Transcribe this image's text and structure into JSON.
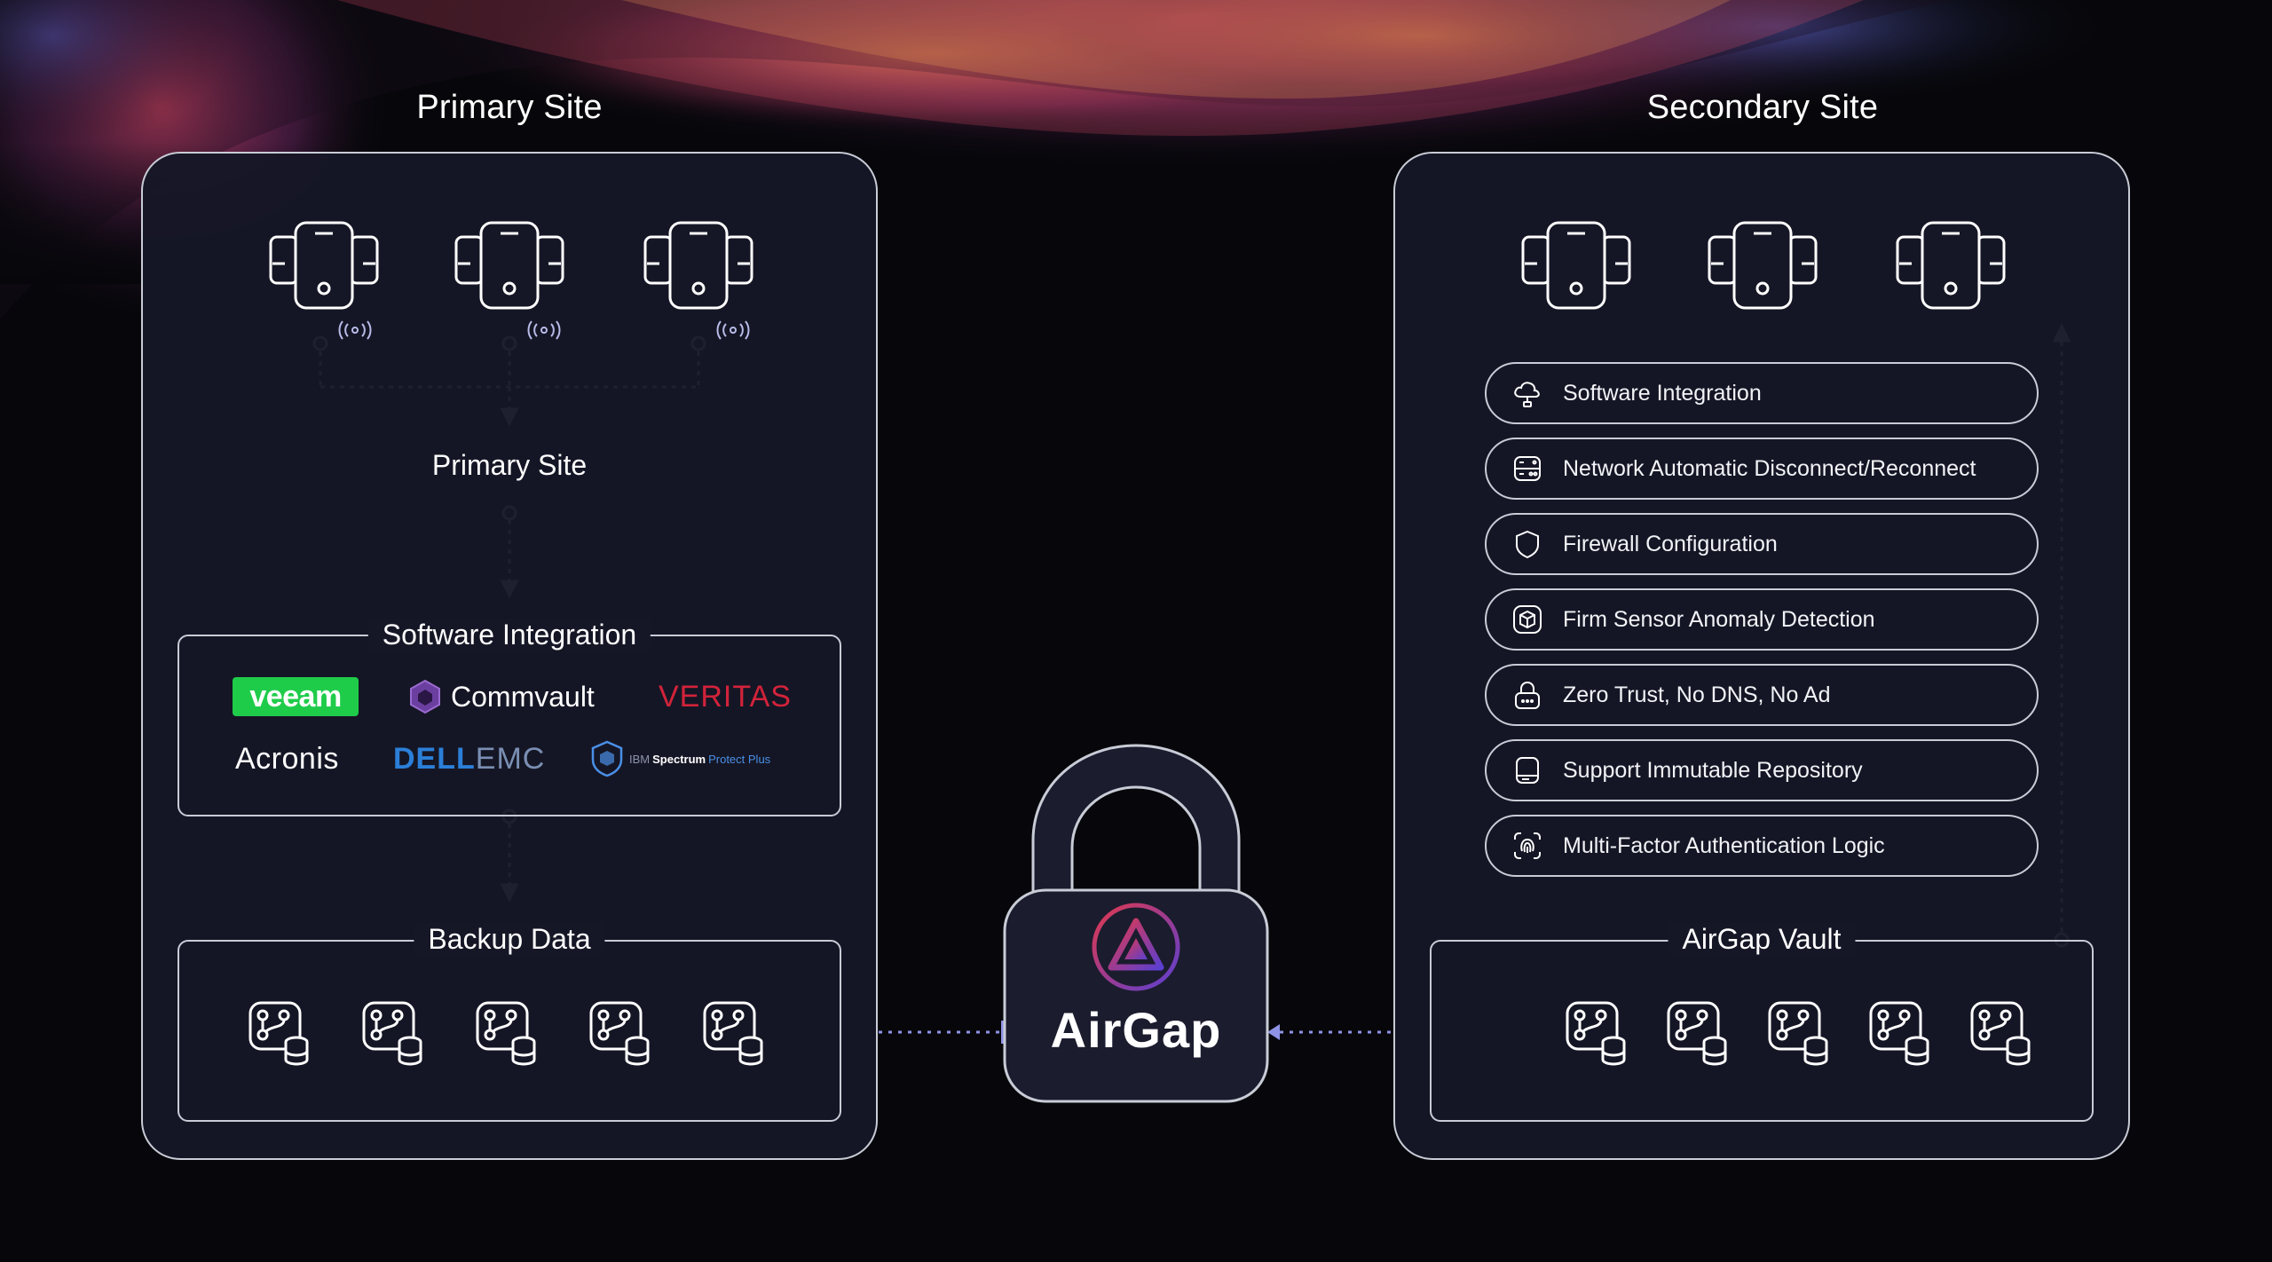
{
  "primary": {
    "title": "Primary Site",
    "node_label": "Primary Site",
    "software_title": "Software Integration",
    "backup_title": "Backup Data",
    "logos": {
      "veeam": "veeam",
      "commvault": "Commvault",
      "veritas": "VERITAS",
      "acronis": "Acronis",
      "dell": "DELL",
      "emc": "EMC",
      "ibm_prefix": "IBM",
      "ibm_spectrum": "Spectrum",
      "ibm_suffix": "Protect Plus"
    },
    "device_icon": "tablet-cluster-icon",
    "signal_icon": "wireless-signal-icon",
    "backup_icon": "database-branch-icon"
  },
  "secondary": {
    "title": "Secondary Site",
    "vault_title": "AirGap Vault",
    "features": [
      {
        "label": "Software Integration",
        "icon": "cloud-plug-icon"
      },
      {
        "label": "Network Automatic Disconnect/Reconnect",
        "icon": "server-network-icon"
      },
      {
        "label": "Firewall Configuration",
        "icon": "shield-icon"
      },
      {
        "label": "Firm Sensor Anomaly Detection",
        "icon": "cube-box-icon"
      },
      {
        "label": "Zero Trust, No DNS, No Ad",
        "icon": "lock-icon"
      },
      {
        "label": "Support Immutable Repository",
        "icon": "storage-drive-icon"
      },
      {
        "label": "Multi-Factor Authentication Logic",
        "icon": "fingerprint-icon"
      }
    ]
  },
  "center": {
    "brand": "AirGap",
    "icon": "padlock-icon"
  },
  "colors": {
    "panel_border": "#c8ccd6",
    "panel_bg": "#161726",
    "connector": "#8f93e6",
    "veeam_green": "#1fcc4a",
    "veritas_red": "#d2233a",
    "dell_blue": "#2b7fd8",
    "logo_gradient_start": "#e0384e",
    "logo_gradient_end": "#5b3fd0"
  }
}
